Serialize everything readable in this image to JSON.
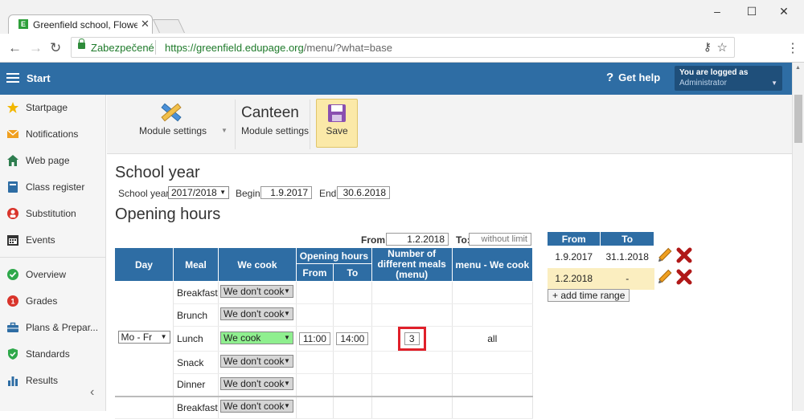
{
  "browser": {
    "tab_title": "Greenfield school, Flower",
    "tab_icon_letter": "E",
    "secure_label": "Zabezpečené",
    "url_host": "https://greenfield.edupage.org",
    "url_path": "/menu/?what=base",
    "window_controls": {
      "minimize": "–",
      "maximize": "☐",
      "close": "✕"
    }
  },
  "header": {
    "start": "Start",
    "help": "Get help",
    "logged_as": "You are logged as",
    "user": "Administrator"
  },
  "sidebar": {
    "items": [
      {
        "label": "Startpage",
        "icon": "star-icon",
        "color": "#f2b700"
      },
      {
        "label": "Notifications",
        "icon": "envelope-icon",
        "color": "#f0a020"
      },
      {
        "label": "Web page",
        "icon": "home-icon",
        "color": "#2e7d4f"
      },
      {
        "label": "Class register",
        "icon": "book-icon",
        "color": "#2e6da4"
      },
      {
        "label": "Substitution",
        "icon": "person-icon",
        "color": "#d9342b"
      },
      {
        "label": "Events",
        "icon": "calendar-icon",
        "color": "#333333"
      },
      {
        "label": "Overview",
        "icon": "check-circle-icon",
        "color": "#2ea84a"
      },
      {
        "label": "Grades",
        "icon": "grades-icon",
        "color": "#d9342b"
      },
      {
        "label": "Plans & Prepar...",
        "icon": "briefcase-icon",
        "color": "#2e6da4"
      },
      {
        "label": "Standards",
        "icon": "shield-icon",
        "color": "#2ea84a"
      },
      {
        "label": "Results",
        "icon": "bar-chart-icon",
        "color": "#2e6da4"
      }
    ]
  },
  "toolbar": {
    "module_settings": "Module settings",
    "title": "Canteen",
    "subtitle": "Module settings",
    "save": "Save"
  },
  "school_year": {
    "heading": "School year",
    "label": "School year:",
    "value": "2017/2018",
    "begin_label": "Begin:",
    "begin": "1.9.2017",
    "end_label": "End:",
    "end": "30.6.2018"
  },
  "opening_hours": {
    "heading": "Opening hours",
    "from_label": "From:",
    "from": "1.2.2018",
    "to_label": "To:",
    "to_placeholder": "without limit",
    "columns": {
      "day": "Day",
      "meal": "Meal",
      "we_cook": "We cook",
      "opening_hours": "Opening hours",
      "from": "From",
      "to": "To",
      "num_meals": "Number of different meals (menu)",
      "menu_we_cook": "menu - We cook"
    },
    "day_value": "Mo - Fr",
    "rows": [
      {
        "meal": "Breakfast",
        "cook": "We don't cook"
      },
      {
        "meal": "Brunch",
        "cook": "We don't cook"
      },
      {
        "meal": "Lunch",
        "cook": "We cook",
        "from": "11:00",
        "to": "14:00",
        "num": "3",
        "menu": "all"
      },
      {
        "meal": "Snack",
        "cook": "We don't cook"
      },
      {
        "meal": "Dinner",
        "cook": "We don't cook"
      },
      {
        "meal": "Breakfast",
        "cook": "We don't cook"
      }
    ]
  },
  "ranges": {
    "col_from": "From",
    "col_to": "To",
    "rows": [
      {
        "from": "1.9.2017",
        "to": "31.1.2018"
      },
      {
        "from": "1.2.2018",
        "to": "-"
      }
    ],
    "add_button": "+ add time range"
  },
  "colors": {
    "accent": "#2e6da4",
    "highlight_box": "#e0202a",
    "cook_green": "#8fef8f",
    "selected_range": "#fbeec0"
  }
}
